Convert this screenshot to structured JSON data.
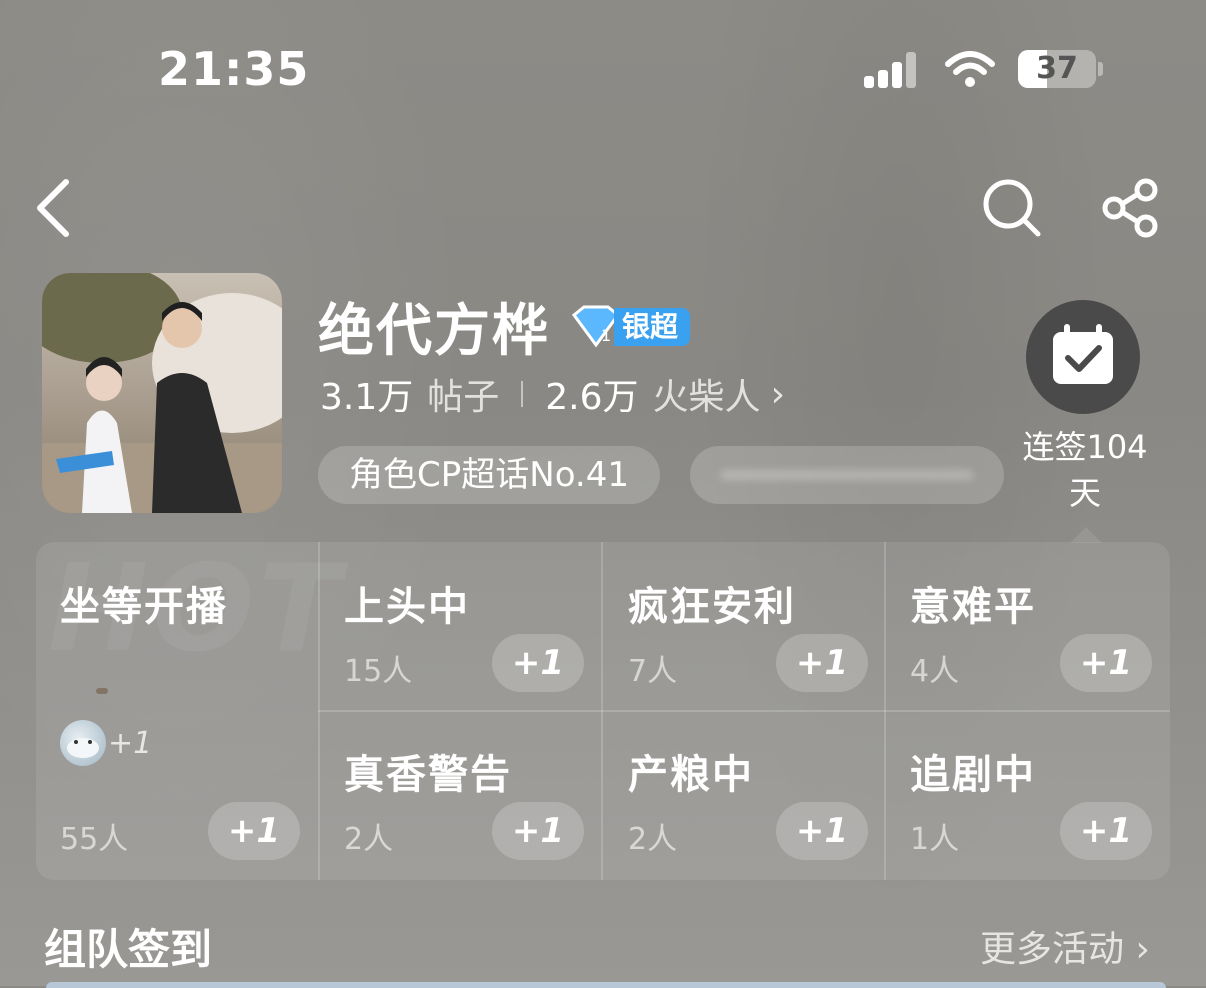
{
  "status_bar": {
    "time": "21:35",
    "battery": "37",
    "battery_level": 0.37
  },
  "header": {
    "title": "绝代方桦",
    "badge_level": "1",
    "badge_label": "银超",
    "posts_count": "3.1万",
    "posts_label": "帖子",
    "fans_count": "2.6万",
    "fans_label": "火柴人",
    "fans_chevron": "›",
    "tag_rank": "角色CP超话No.41",
    "checkin_text_line1": "连签104",
    "checkin_text_line2": "天"
  },
  "watermark": "HOT",
  "grid": {
    "cells": [
      {
        "title": "坐等开播",
        "count": "55人",
        "button": "+1"
      },
      {
        "title": "上头中",
        "count": "15人",
        "button": "+1"
      },
      {
        "title": "疯狂安利",
        "count": "7人",
        "button": "+1"
      },
      {
        "title": "意难平",
        "count": "4人",
        "button": "+1"
      },
      {
        "title": "真香警告",
        "count": "2人",
        "button": "+1"
      },
      {
        "title": "产粮中",
        "count": "2人",
        "button": "+1"
      },
      {
        "title": "追剧中",
        "count": "1人",
        "button": "+1"
      }
    ],
    "avatar_plus": "+1"
  },
  "section": {
    "title": "组队签到",
    "more": "更多活动 ›"
  },
  "colors": {
    "badge_blue": "#3aa0f0",
    "checkin_bg": "#4a4a4a"
  },
  "icons": [
    "back-icon",
    "search-icon",
    "share-icon",
    "calendar-check-icon",
    "diamond-badge-icon"
  ]
}
